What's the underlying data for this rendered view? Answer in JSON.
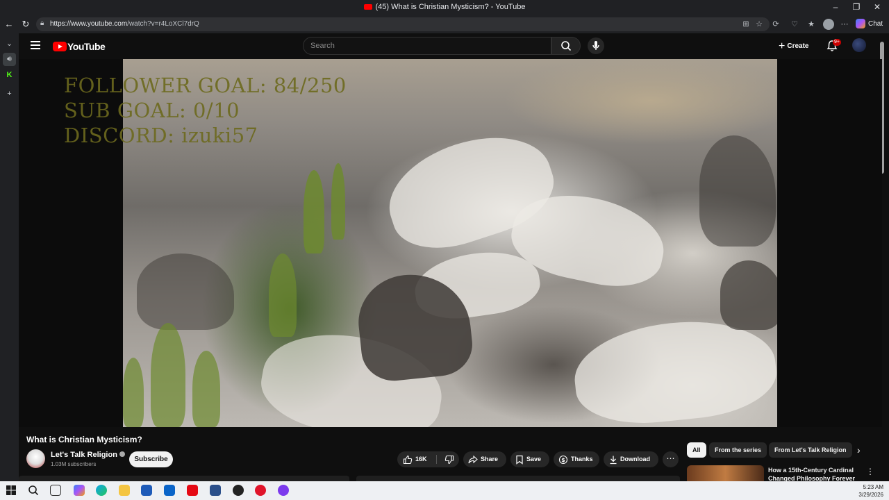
{
  "browser": {
    "window_title": "(45) What is Christian Mysticism? - YouTube",
    "url_host": "https://www.youtube.com",
    "url_path": "/watch?v=r4LoXCl7drQ",
    "chat_label": "Chat"
  },
  "youtube": {
    "logo_text": "YouTube",
    "search_placeholder": "Search",
    "create_label": "Create",
    "notification_badge": "9+"
  },
  "video": {
    "overlay_lines": [
      "FOLLOWER GOAL: 84/250",
      "SUB GOAL: 0/10",
      "DISCORD: izuki57"
    ],
    "title": "What is Christian Mysticism?",
    "channel_name": "Let's Talk Religion",
    "subscribers": "1.03M subscribers",
    "subscribe_label": "Subscribe",
    "like_count": "16K",
    "share_label": "Share",
    "save_label": "Save",
    "thanks_label": "Thanks",
    "download_label": "Download"
  },
  "chips": [
    "All",
    "From the series",
    "From Let's Talk Religion"
  ],
  "recommendation": {
    "title": "How a 15th-Century Cardinal Changed Philosophy Forever"
  },
  "taskbar": {
    "time": "5:23 AM",
    "date": "3/29/2026"
  },
  "colors": {
    "youtube_red": "#ff0000",
    "page_bg": "#0f0f0f",
    "overlay_text": "#6d6a1e"
  }
}
